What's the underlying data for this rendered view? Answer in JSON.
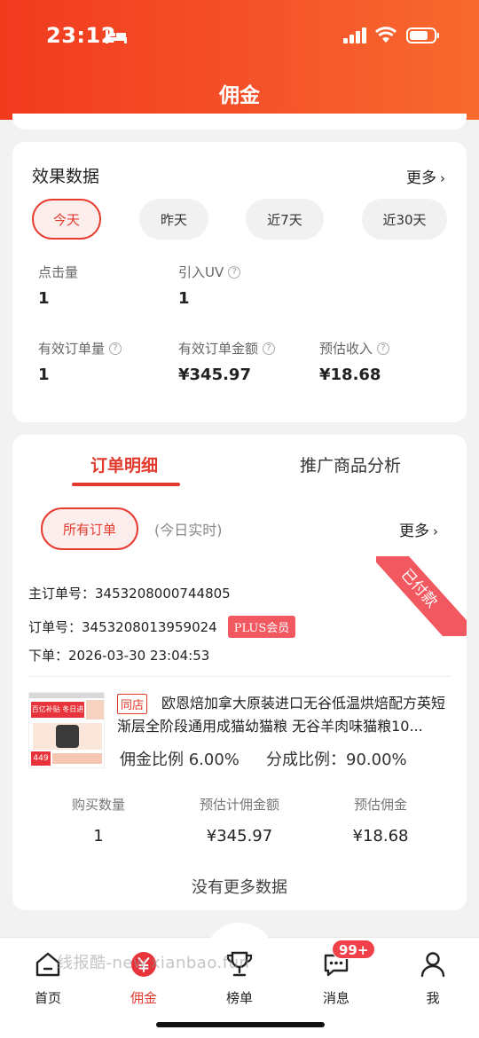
{
  "status_bar": {
    "time": "23:12"
  },
  "header": {
    "title": "佣金"
  },
  "effect": {
    "title": "效果数据",
    "more": "更多",
    "periods": [
      "今天",
      "昨天",
      "近7天",
      "近30天"
    ],
    "active_period": "今天",
    "metrics": {
      "clicks_label": "点击量",
      "clicks_value": "1",
      "uv_label": "引入UV",
      "uv_value": "1",
      "orders_label": "有效订单量",
      "orders_value": "1",
      "amount_label": "有效订单金额",
      "amount_value": "¥345.97",
      "income_label": "预估收入",
      "income_value": "¥18.68"
    }
  },
  "orders": {
    "tabs": [
      "订单明细",
      "推广商品分析"
    ],
    "filter": "所有订单",
    "realtime": "(今日实时)",
    "more": "更多",
    "status_ribbon": "已付款",
    "main_order": "主订单号：3453208000744805",
    "order_no": "订单号：3453208013959024",
    "member_badge": "PLUS会员",
    "placed": "下单：2026-03-30 23:04:53",
    "product": {
      "shop_tag": "同店",
      "title": "欧恩焙加拿大原装进口无谷低温烘焙配方英短渐层全阶段通用成猫幼猫粮 无谷羊肉味猫粮10...",
      "commission_ratio": "佣金比例 6.00%",
      "share_ratio": "分成比例：90.00%",
      "thumb_banner": "百亿补贴 冬日进补",
      "thumb_price": "449"
    },
    "summary": [
      {
        "label": "购买数量",
        "value": "1"
      },
      {
        "label": "预估计佣金额",
        "value": "¥345.97"
      },
      {
        "label": "预估佣金",
        "value": "¥18.68"
      }
    ],
    "no_more": "没有更多数据"
  },
  "tabbar": {
    "items": [
      "首页",
      "佣金",
      "榜单",
      "消息",
      "我"
    ],
    "active": "佣金",
    "message_badge": "99+"
  },
  "watermark": "线报酷-new.xianbao.fun",
  "colors": {
    "accent": "#e23b2e",
    "header_start": "#f23a1f",
    "header_end": "#f86a2e",
    "ribbon": "#f2585f"
  }
}
